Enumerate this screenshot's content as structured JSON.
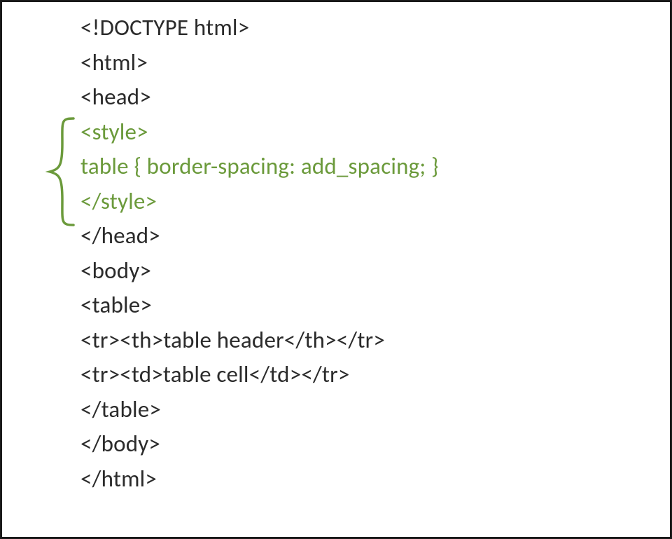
{
  "code": {
    "lines": [
      "<!DOCTYPE html>",
      "<html>",
      "<head>",
      "<style>",
      "table { border-spacing: add_spacing; }",
      "</style>",
      "</head>",
      "<body>",
      "<table>",
      "<tr><th>table header</th></tr>",
      "<tr><td>table cell</td></tr>",
      "</table>",
      "</body>",
      "</html>"
    ],
    "highlight_start": 3,
    "highlight_end": 5
  },
  "colors": {
    "highlight": "#6b9a3b",
    "text": "#2b2b2b",
    "border": "#1a1a1a"
  }
}
